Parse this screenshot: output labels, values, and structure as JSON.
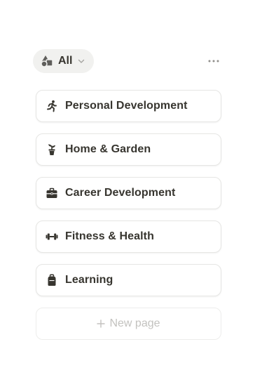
{
  "view_bar": {
    "active_view_label": "All",
    "view_icon": "shapes-icon",
    "dropdown_icon": "chevron-down-icon",
    "more_icon": "more-horizontal-icon"
  },
  "cards": [
    {
      "title": "Personal Development",
      "icon": "person-running-icon"
    },
    {
      "title": "Home & Garden",
      "icon": "potted-plant-icon"
    },
    {
      "title": "Career Development",
      "icon": "briefcase-icon"
    },
    {
      "title": "Fitness & Health",
      "icon": "dumbbell-icon"
    },
    {
      "title": "Learning",
      "icon": "backpack-icon"
    }
  ],
  "new_page": {
    "label": "New page",
    "icon": "plus-icon"
  },
  "colors": {
    "text": "#37352f",
    "tab_background": "#f1f1ef",
    "card_border": "#e6e6e4",
    "placeholder_text": "#c3c2bf"
  }
}
